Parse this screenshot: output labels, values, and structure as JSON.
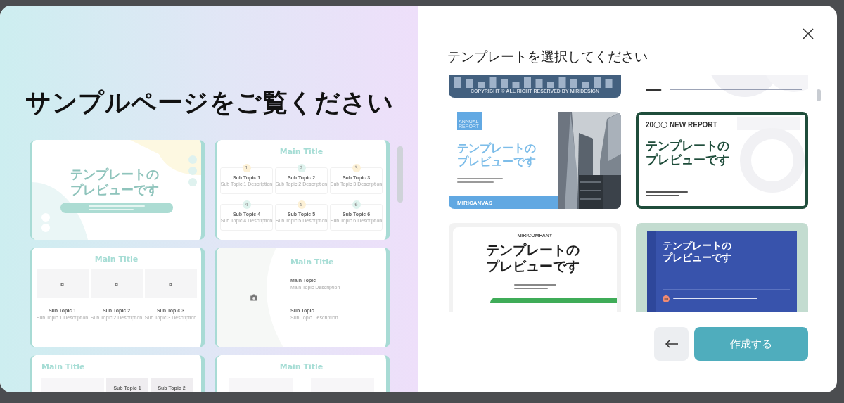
{
  "left_panel": {
    "title": "サンプルページをご覧ください",
    "slides": [
      {
        "kind": "cover",
        "title": "テンプレートのプレビューです"
      },
      {
        "kind": "grid6",
        "title": "Main Title",
        "items": [
          {
            "number": "1",
            "name": "Sub Topic 1",
            "description": "Sub Topic 1 Description"
          },
          {
            "number": "2",
            "name": "Sub Topic 2",
            "description": "Sub Topic 2 Description"
          },
          {
            "number": "3",
            "name": "Sub Topic 3",
            "description": "Sub Topic 3 Description"
          },
          {
            "number": "4",
            "name": "Sub Topic 4",
            "description": "Sub Topic 4 Description"
          },
          {
            "number": "5",
            "name": "Sub Topic 5",
            "description": "Sub Topic 5 Description"
          },
          {
            "number": "6",
            "name": "Sub Topic 6",
            "description": "Sub Topic 6 Description"
          }
        ]
      },
      {
        "kind": "grid3",
        "title": "Main Title",
        "items": [
          {
            "name": "Sub Topic 1",
            "description": "Sub Topic 1 Description"
          },
          {
            "name": "Sub Topic 2",
            "description": "Sub Topic 2 Description"
          },
          {
            "name": "Sub Topic 3",
            "description": "Sub Topic 3 Description"
          }
        ]
      },
      {
        "title": "Main Title",
        "items": [
          {
            "name": "Main Topic",
            "description": "Main Topic Description"
          },
          {
            "name": "Sub Topic",
            "description": "Sub Topic Description"
          }
        ]
      },
      {
        "kind": "split",
        "title": "Main Title",
        "items": [
          {
            "name": "Sub Topic 1"
          },
          {
            "name": "Sub Topic 2"
          }
        ]
      },
      {
        "kind": "pair",
        "title": "Main Title"
      }
    ]
  },
  "right_panel": {
    "heading": "テンプレートを選択してください",
    "templates": [
      {
        "kind": "city",
        "selected": false,
        "footer": "COPYRIGHT © ALL RIGHT RESERVED BY MIRIDESIGN"
      },
      {
        "kind": "date",
        "selected": false
      },
      {
        "kind": "annual",
        "selected": false,
        "label": "ANNUAL REPORT",
        "title": "テンプレートのプレビューです",
        "brand": "MIRICANVAS"
      },
      {
        "kind": "report",
        "selected": true,
        "label": "20〇〇 NEW REPORT",
        "title": "テンプレートのプレビューです"
      },
      {
        "kind": "company",
        "selected": false,
        "brand": "MIRICOMPANY",
        "title": "テンプレートのプレビューです"
      },
      {
        "kind": "blue",
        "selected": false,
        "title": "テンプレートのプレビューです"
      }
    ],
    "create_button": "作成する"
  }
}
